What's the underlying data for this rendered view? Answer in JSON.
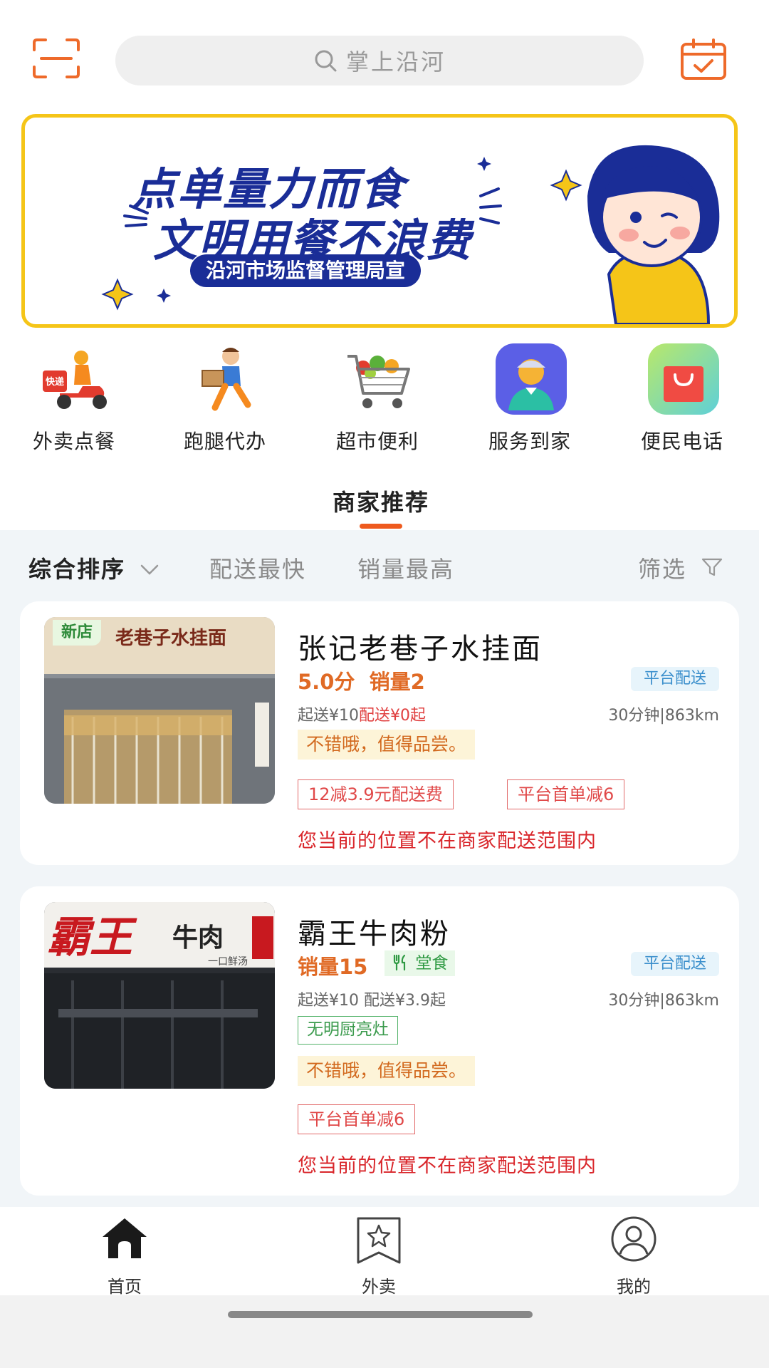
{
  "search": {
    "placeholder": "掌上沿河"
  },
  "banner": {
    "line1": "点单量力而食",
    "line2": "文明用餐不浪费",
    "pill": "沿河市场监督管理局宣"
  },
  "categories": [
    {
      "label": "外卖点餐",
      "icon": "delivery-scooter-icon"
    },
    {
      "label": "跑腿代办",
      "icon": "errand-runner-icon"
    },
    {
      "label": "超市便利",
      "icon": "shopping-cart-icon"
    },
    {
      "label": "服务到家",
      "icon": "service-person-icon"
    },
    {
      "label": "便民电话",
      "icon": "shopping-bag-icon"
    }
  ],
  "scooter_box_text": "快递",
  "section_title": "商家推荐",
  "sort": {
    "comprehensive": "综合排序",
    "fastest": "配送最快",
    "sales": "销量最高",
    "filter": "筛选"
  },
  "shops": [
    {
      "name": "张记老巷子水挂面",
      "badge": "新店",
      "sign_text": "老巷子水挂面",
      "score": "5.0分",
      "sales": "销量2",
      "platform": "平台配送",
      "min_order": "起送¥10",
      "delivery_fee": "配送¥0起",
      "eta": "30分钟|863km",
      "review": "不错哦，值得品尝。",
      "promos": [
        "12减3.9元配送费",
        "平台首单减6"
      ],
      "warning": "您当前的位置不在商家配送范围内"
    },
    {
      "name": "霸王牛肉粉",
      "sign_text_1": "霸王",
      "sign_text_2": "牛肉",
      "sign_text_3": "一口鲜汤",
      "sales": "销量15",
      "dine_in": "堂食",
      "platform": "平台配送",
      "min_delivery": "起送¥10 配送¥3.9起",
      "eta": "30分钟|863km",
      "kitchen": "无明厨亮灶",
      "review": "不错哦，值得品尝。",
      "promos": [
        "平台首单减6"
      ],
      "warning": "您当前的位置不在商家配送范围内"
    }
  ],
  "nav": [
    {
      "label": "首页",
      "icon": "home-icon"
    },
    {
      "label": "外卖",
      "icon": "bookmark-star-icon"
    },
    {
      "label": "我的",
      "icon": "user-icon"
    }
  ],
  "colors": {
    "accent": "#ee5a1e",
    "banner_border": "#f5c518",
    "banner_text": "#1a2d97",
    "warning": "#d9262b"
  }
}
